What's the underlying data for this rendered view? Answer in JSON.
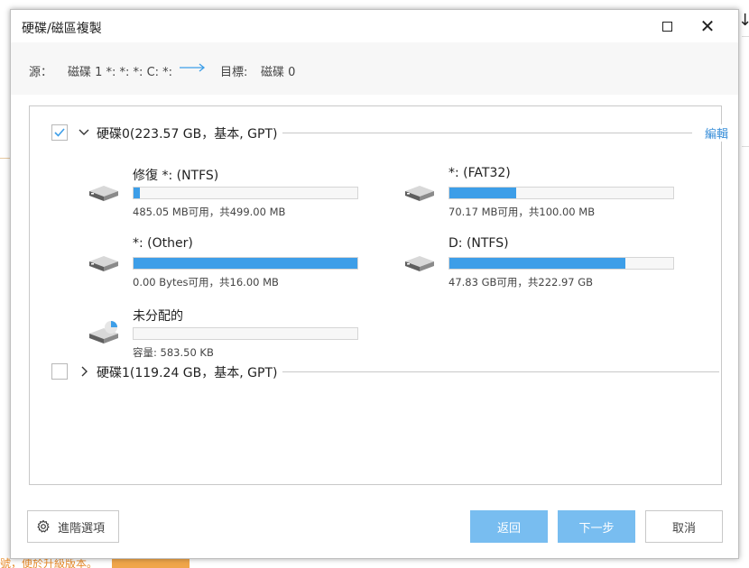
{
  "window": {
    "title": "硬碟/磁區複製",
    "maximize_label": "□",
    "close_label": "✕"
  },
  "source_bar": {
    "source_label": "源：",
    "source_value": "磁碟 1 *: *: *: C: *:",
    "target_label": "目標:",
    "target_value": "磁碟 0",
    "arrow_color": "#3d9ee8"
  },
  "disks": [
    {
      "title": "硬碟0(223.57 GB，基本, GPT)",
      "checked": true,
      "expanded": true,
      "edit_label": "編輯",
      "partitions": [
        {
          "name": "修復 *: (NTFS)",
          "info": "485.05 MB可用，共499.00 MB",
          "used_fraction": 0.028,
          "icon": "drive-icon"
        },
        {
          "name": "*: (FAT32)",
          "info": "70.17 MB可用，共100.00 MB",
          "used_fraction": 0.298,
          "icon": "drive-icon"
        },
        {
          "name": "*: (Other)",
          "info": "0.00 Bytes可用，共16.00 MB",
          "used_fraction": 1.0,
          "icon": "drive-icon"
        },
        {
          "name": "D: (NTFS)",
          "info": "47.83 GB可用，共222.97 GB",
          "used_fraction": 0.785,
          "icon": "drive-icon"
        },
        {
          "name": "未分配的",
          "info": "容量: 583.50 KB",
          "used_fraction": 0.0,
          "icon": "unallocated-drive-icon"
        }
      ]
    },
    {
      "title": "硬碟1(119.24 GB，基本, GPT)",
      "checked": false,
      "expanded": false
    }
  ],
  "footer": {
    "advanced_label": "進階選項",
    "back_label": "返回",
    "next_label": "下一步",
    "cancel_label": "取消"
  },
  "background": {
    "bottom_text": "號，便於升級版本。"
  },
  "colors": {
    "accent": "#3d9ee8",
    "primary_button": "#78bdf0",
    "link": "#3a8fd9"
  }
}
